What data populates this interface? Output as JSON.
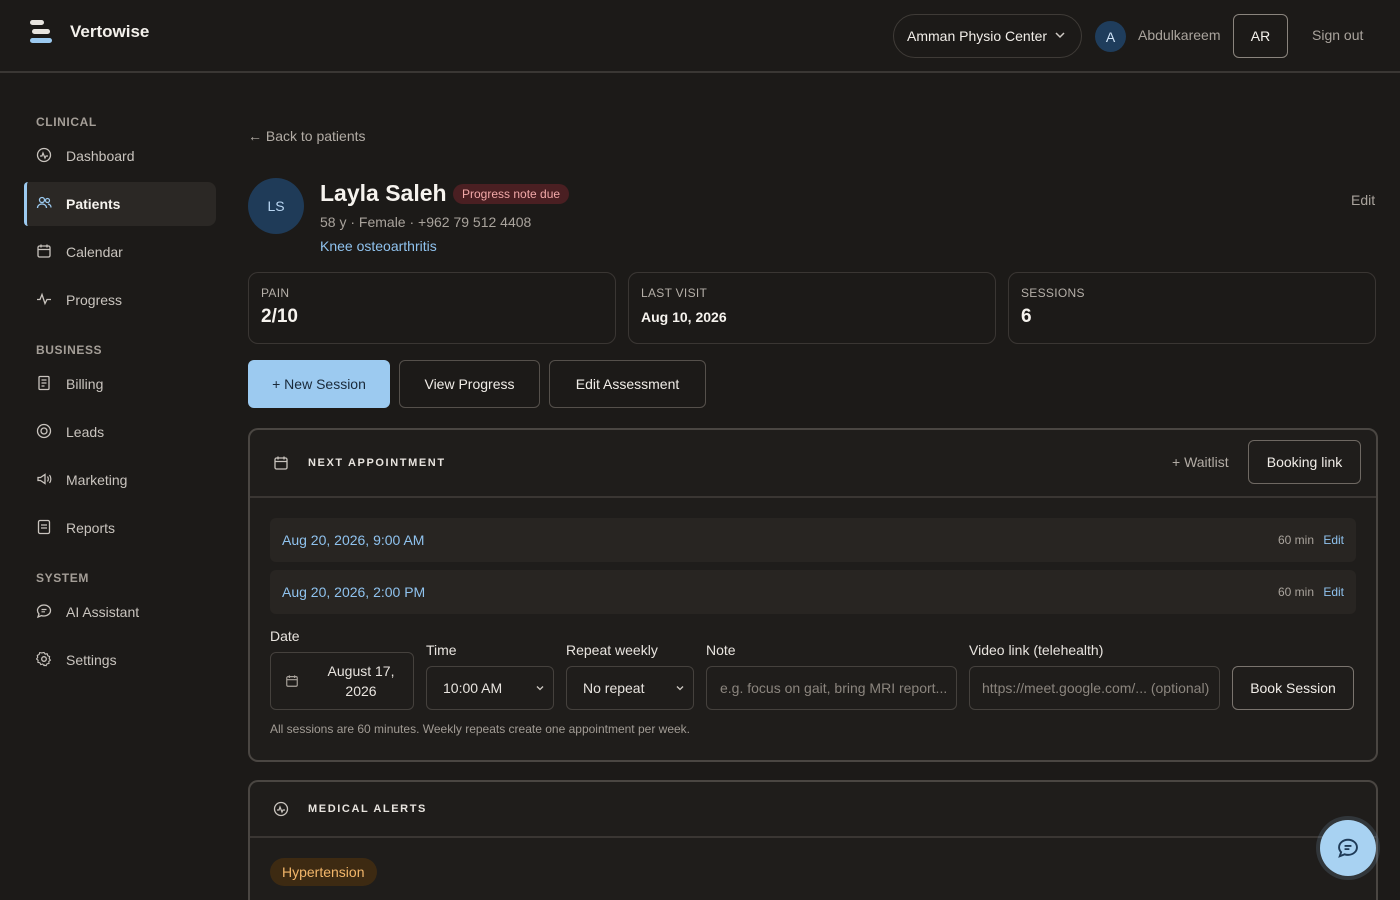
{
  "app": {
    "brand": "Vertowise"
  },
  "header": {
    "clinic": "Amman Physio Center",
    "avatar_letter": "A",
    "username": "Abdulkareem",
    "lang": "AR",
    "signout": "Sign out"
  },
  "sidebar": {
    "sections": [
      {
        "title": "CLINICAL"
      },
      {
        "title": "BUSINESS"
      },
      {
        "title": "SYSTEM"
      }
    ],
    "items": [
      {
        "label": "Dashboard",
        "icon": "dashboard-icon"
      },
      {
        "label": "Patients",
        "icon": "users-icon",
        "active": true
      },
      {
        "label": "Calendar",
        "icon": "calendar-icon"
      },
      {
        "label": "Progress",
        "icon": "activity-icon"
      },
      {
        "label": "Billing",
        "icon": "receipt-icon"
      },
      {
        "label": "Leads",
        "icon": "target-icon"
      },
      {
        "label": "Marketing",
        "icon": "megaphone-icon"
      },
      {
        "label": "Reports",
        "icon": "report-icon"
      },
      {
        "label": "AI Assistant",
        "icon": "chat-icon"
      },
      {
        "label": "Settings",
        "icon": "gear-icon"
      }
    ]
  },
  "main": {
    "back": "← Back to patients",
    "patient": {
      "initials": "LS",
      "name": "Layla Saleh",
      "badge": "Progress note due",
      "meta": "58 y · Female · +962 79 512 4408",
      "diagnosis": "Knee osteoarthritis",
      "edit": "Edit"
    },
    "stats": [
      {
        "label": "PAIN",
        "value": "2/10"
      },
      {
        "label": "LAST VISIT",
        "value": "Aug 10, 2026"
      },
      {
        "label": "SESSIONS",
        "value": "6"
      }
    ],
    "actions": {
      "new_session": "+ New Session",
      "view_progress": "View Progress",
      "edit_assessment": "Edit Assessment"
    },
    "next_appointment": {
      "title": "NEXT APPOINTMENT",
      "waitlist": "+ Waitlist",
      "booking_link": "Booking link",
      "appointments": [
        {
          "when": "Aug 20, 2026, 9:00 AM",
          "duration": "60 min",
          "edit": "Edit"
        },
        {
          "when": "Aug 20, 2026, 2:00 PM",
          "duration": "60 min",
          "edit": "Edit"
        }
      ],
      "form": {
        "date_label": "Date",
        "date_value": "August 17, 2026",
        "time_label": "Time",
        "time_value": "10:00 AM",
        "repeat_label": "Repeat weekly",
        "repeat_value": "No repeat",
        "note_label": "Note",
        "note_placeholder": "e.g. focus on gait, bring MRI report...",
        "video_label": "Video link (telehealth)",
        "video_placeholder": "https://meet.google.com/... (optional)",
        "book": "Book Session",
        "hint": "All sessions are 60 minutes. Weekly repeats create one appointment per week."
      }
    },
    "medical_alerts": {
      "title": "MEDICAL ALERTS",
      "items": [
        "Hypertension"
      ]
    }
  },
  "colors": {
    "background": "#1c1a18",
    "accent": "#9ccaf0",
    "badge_bg": "#4a1f22",
    "badge_text": "#f2a8a8",
    "alert_bg": "#3d2a12",
    "alert_text": "#f2b66a"
  }
}
